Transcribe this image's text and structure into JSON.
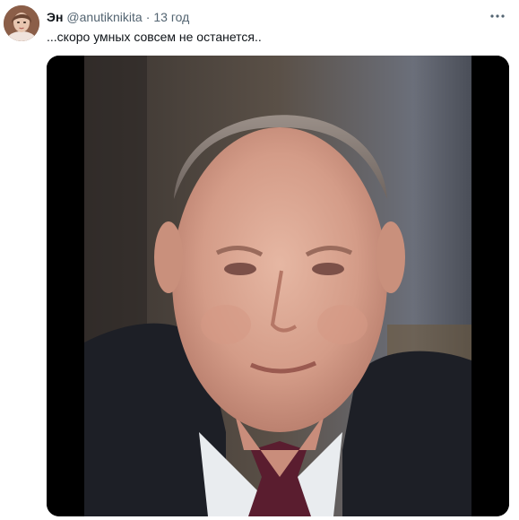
{
  "post": {
    "author_name": "Эн",
    "author_handle": "@anutiknikita",
    "separator": "·",
    "timestamp": "13 год",
    "text": "...скоро умных совсем не останется..",
    "more_icon": "more-dots-icon",
    "avatar_icon": "user-avatar"
  },
  "colors": {
    "text_primary": "#0f1419",
    "text_secondary": "#536471",
    "media_background": "#000000"
  }
}
